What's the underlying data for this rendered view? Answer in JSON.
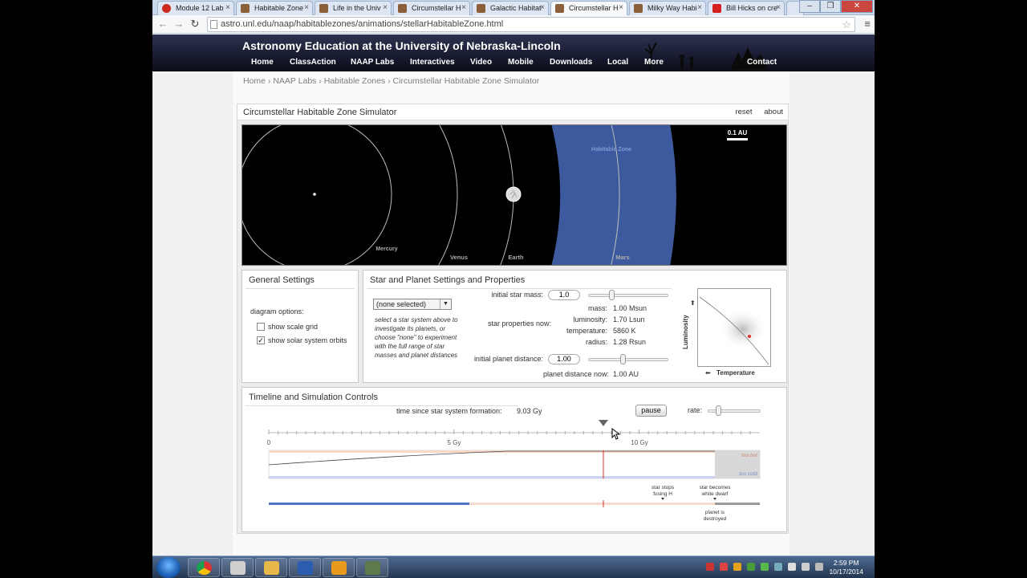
{
  "browser": {
    "tabs": [
      {
        "label": "Module 12 Lab"
      },
      {
        "label": "Habitable Zone"
      },
      {
        "label": "Life in the Univ"
      },
      {
        "label": "Circumstellar H"
      },
      {
        "label": "Galactic Habitat"
      },
      {
        "label": "Circumstellar H"
      },
      {
        "label": "Milky Way Habi"
      },
      {
        "label": "Bill Hicks on cre"
      }
    ],
    "active_tab_index": 5,
    "url": "astro.unl.edu/naap/habitablezones/animations/stellarHabitableZone.html"
  },
  "site": {
    "title": "Astronomy Education at the University of Nebraska-Lincoln",
    "nav": [
      "Home",
      "ClassAction",
      "NAAP Labs",
      "Interactives",
      "Video",
      "Mobile",
      "Downloads",
      "Local",
      "More",
      "Contact"
    ]
  },
  "breadcrumb": "Home › NAAP Labs › Habitable Zones › Circumstellar Habitable Zone Simulator",
  "sim": {
    "title": "Circumstellar Habitable Zone Simulator",
    "links": {
      "reset": "reset",
      "about": "about"
    },
    "orbit_view": {
      "scale_label": "0.1 AU",
      "zone_label": "Habitable Zone",
      "planets": [
        "Mercury",
        "Venus",
        "Earth",
        "Mars"
      ]
    },
    "general": {
      "title": "General Settings",
      "diagram_options": "diagram options:",
      "show_scale_grid": {
        "label": "show scale grid",
        "checked": false
      },
      "show_orbits": {
        "label": "show solar system orbits",
        "checked": true
      }
    },
    "star_planet": {
      "title": "Star and Planet Settings and Properties",
      "preset_select": "(none selected)",
      "note": "select a star system above to investigate its planets, or choose \"none\" to experiment with the full range of star masses and planet distances",
      "initial_star_mass_label": "initial star mass:",
      "initial_star_mass_value": "1.0",
      "star_properties_label": "star properties now:",
      "props": [
        {
          "label": "mass:",
          "value": "1.00 Msun"
        },
        {
          "label": "luminosity:",
          "value": "1.70 Lsun"
        },
        {
          "label": "temperature:",
          "value": "5860 K"
        },
        {
          "label": "radius:",
          "value": "1.28 Rsun"
        }
      ],
      "initial_planet_distance_label": "initial planet distance:",
      "initial_planet_distance_value": "1.00",
      "planet_distance_now_label": "planet distance now:",
      "planet_distance_now_value": "1.00 AU",
      "hr_y_label": "Luminosity",
      "hr_x_label": "Temperature"
    },
    "timeline": {
      "title": "Timeline and Simulation Controls",
      "time_label": "time since star system formation:",
      "time_value": "9.03 Gy",
      "pause_label": "pause",
      "rate_label": "rate:",
      "ticks": [
        "0",
        "5 Gy",
        "10 Gy"
      ],
      "too_hot": "too hot",
      "too_cold": "too cold",
      "event_stops_fusing": "star stops fusing H",
      "event_white_dwarf": "star becomes white dwarf",
      "event_destroyed": "planet is destroyed"
    }
  },
  "taskbar": {
    "time": "2:59 PM",
    "date": "10/17/2014"
  },
  "colors": {
    "habitable_zone": "#3d5a9e",
    "nav_bg": "#14172a",
    "star_marker": "#d9322b",
    "close_red": "#c9473d"
  }
}
